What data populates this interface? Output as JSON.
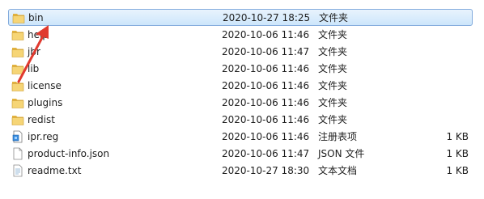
{
  "files": [
    {
      "name": "bin",
      "date": "2020-10-27 18:25",
      "type": "文件夹",
      "size": "",
      "icon": "folder-icon",
      "selected": true
    },
    {
      "name": "help",
      "date": "2020-10-06 11:46",
      "type": "文件夹",
      "size": "",
      "icon": "folder-icon"
    },
    {
      "name": "jbr",
      "date": "2020-10-06 11:47",
      "type": "文件夹",
      "size": "",
      "icon": "folder-icon"
    },
    {
      "name": "lib",
      "date": "2020-10-06 11:46",
      "type": "文件夹",
      "size": "",
      "icon": "folder-icon"
    },
    {
      "name": "license",
      "date": "2020-10-06 11:46",
      "type": "文件夹",
      "size": "",
      "icon": "folder-icon"
    },
    {
      "name": "plugins",
      "date": "2020-10-06 11:46",
      "type": "文件夹",
      "size": "",
      "icon": "folder-icon"
    },
    {
      "name": "redist",
      "date": "2020-10-06 11:46",
      "type": "文件夹",
      "size": "",
      "icon": "folder-icon"
    },
    {
      "name": "ipr.reg",
      "date": "2020-10-06 11:46",
      "type": "注册表项",
      "size": "1 KB",
      "icon": "registry-file-icon"
    },
    {
      "name": "product-info.json",
      "date": "2020-10-06 11:47",
      "type": "JSON 文件",
      "size": "1 KB",
      "icon": "document-icon"
    },
    {
      "name": "readme.txt",
      "date": "2020-10-27 18:30",
      "type": "文本文档",
      "size": "1 KB",
      "icon": "text-file-icon"
    }
  ],
  "colors": {
    "selection_border": "#84acdd",
    "folder": "#f0c85a",
    "arrow": "#e03a2f"
  }
}
